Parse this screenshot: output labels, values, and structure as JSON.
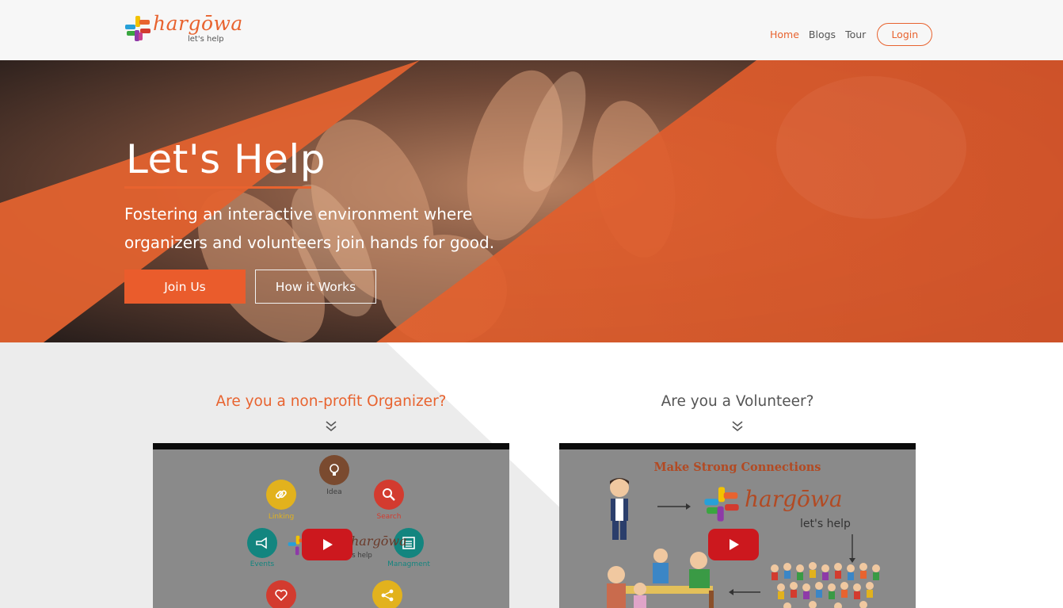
{
  "header": {
    "logo_word": "hargōwa",
    "logo_tagline": "let's help",
    "nav": [
      {
        "label": "Home",
        "active": true
      },
      {
        "label": "Blogs",
        "active": false
      },
      {
        "label": "Tour",
        "active": false
      }
    ],
    "login_label": "Login"
  },
  "hero": {
    "title": "Let's Help",
    "subtitle": "Fostering an interactive environment where organizers and volunteers join hands for good.",
    "join_label": "Join Us",
    "how_label": "How it Works"
  },
  "sections": {
    "organizer": {
      "question": "Are you a non-profit Organizer?",
      "video_items": [
        {
          "label": "Idea",
          "icon": "lightbulb-icon",
          "color": "#7a4a2f"
        },
        {
          "label": "Linking",
          "icon": "link-icon",
          "color": "#e2b21d"
        },
        {
          "label": "Search",
          "icon": "search-icon",
          "color": "#d33b2f"
        },
        {
          "label": "Events",
          "icon": "megaphone-icon",
          "color": "#13857f"
        },
        {
          "label": "Managment",
          "icon": "list-icon",
          "color": "#13857f"
        },
        {
          "label": "",
          "icon": "heart-icon",
          "color": "#d33b2f"
        },
        {
          "label": "",
          "icon": "share-icon",
          "color": "#e2b21d"
        }
      ],
      "video_logo_word": "hargōwa",
      "video_logo_tagline": "let's help"
    },
    "volunteer": {
      "question": "Are you a Volunteer?",
      "video_title": "Make Strong Connections",
      "video_logo_word": "hargōwa",
      "video_logo_tagline": "let's help"
    }
  },
  "colors": {
    "accent": "#e8632f",
    "hero_orange": "#e2622f",
    "youtube_red": "#cc181e"
  }
}
